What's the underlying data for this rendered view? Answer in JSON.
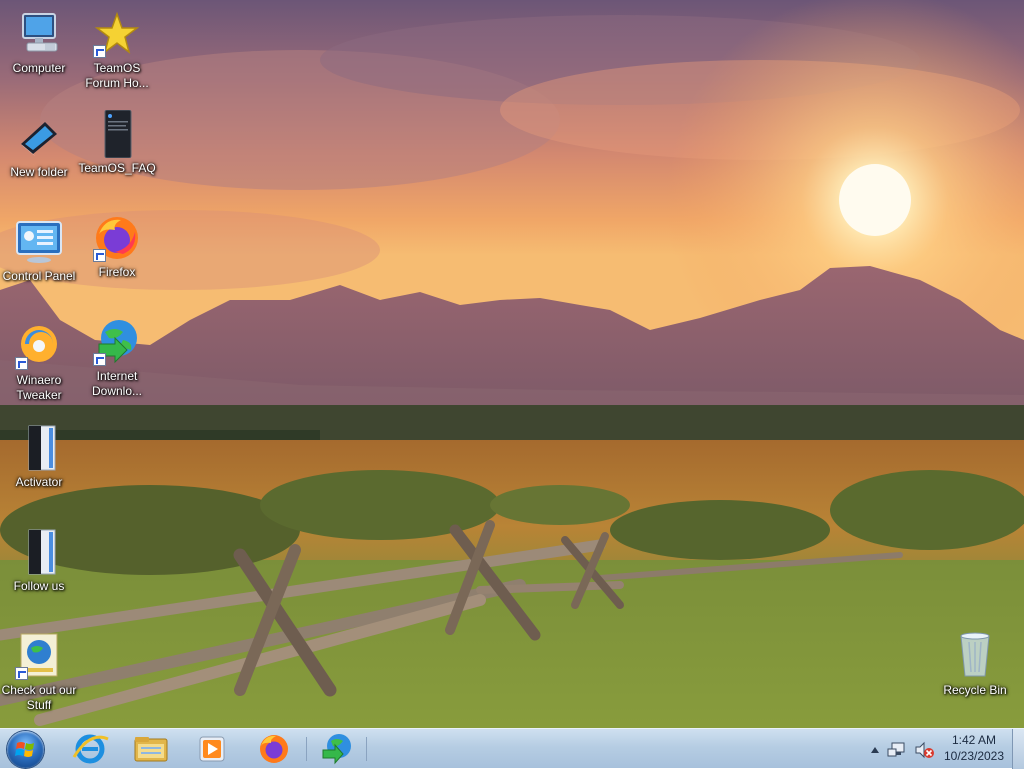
{
  "desktop": {
    "icons": [
      {
        "label": "Computer"
      },
      {
        "label": "TeamOS Forum Ho..."
      },
      {
        "label": "New folder"
      },
      {
        "label": "TeamOS_FAQ"
      },
      {
        "label": "Control Panel"
      },
      {
        "label": "Firefox"
      },
      {
        "label": "Winaero Tweaker"
      },
      {
        "label": "Internet Downlo..."
      },
      {
        "label": "Activator"
      },
      {
        "label": "Follow us"
      },
      {
        "label": "Check out our Stuff"
      },
      {
        "label": "Recycle Bin"
      }
    ]
  },
  "taskbar": {
    "pinned": [
      "Internet Explorer",
      "Windows Explorer",
      "Windows Media Player",
      "Firefox",
      "Internet Download Manager"
    ],
    "clock": {
      "time": "1:42 AM",
      "date": "10/23/2023"
    }
  },
  "colors": {
    "taskbar": "#b6cde3",
    "sky_top": "#6e5a7a",
    "sun": "#fff2c4"
  }
}
